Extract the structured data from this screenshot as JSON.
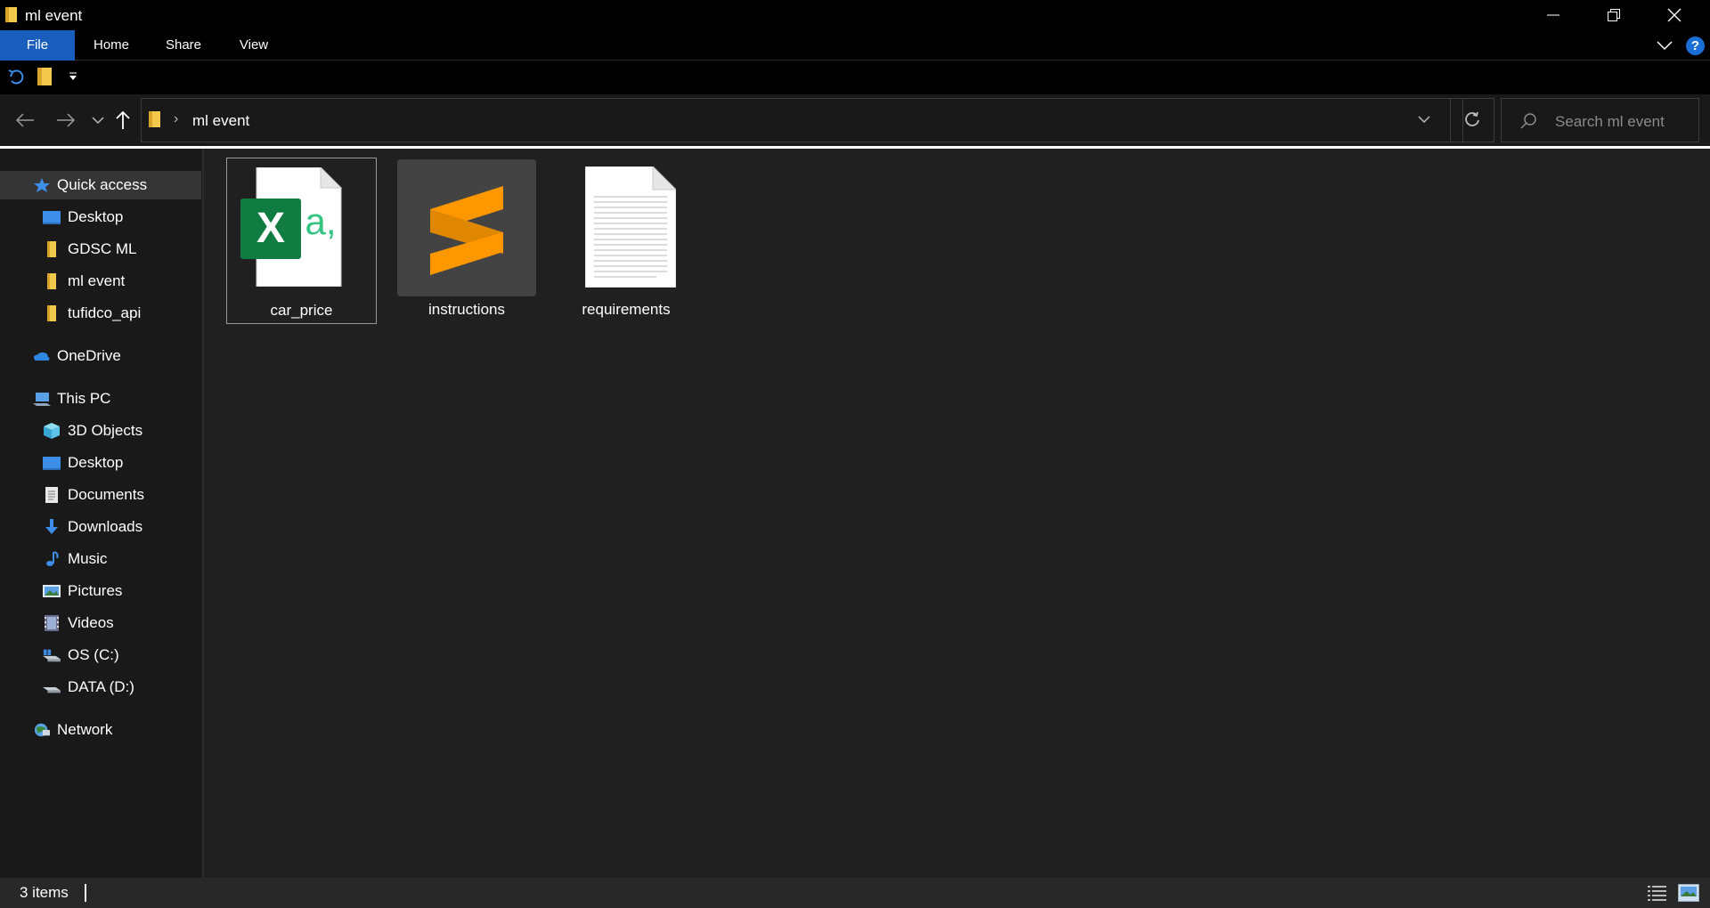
{
  "window": {
    "title": "ml event"
  },
  "ribbon": {
    "tabs": [
      {
        "label": "File"
      },
      {
        "label": "Home"
      },
      {
        "label": "Share"
      },
      {
        "label": "View"
      }
    ],
    "help_label": "?"
  },
  "address": {
    "separator": "›",
    "path": "ml event"
  },
  "search": {
    "placeholder": "Search ml event"
  },
  "sidebar": {
    "items": [
      {
        "label": "Quick access",
        "icon": "star-icon",
        "selected": true
      },
      {
        "label": "Desktop",
        "icon": "desktop-icon"
      },
      {
        "label": "GDSC ML",
        "icon": "folder-icon"
      },
      {
        "label": "ml event",
        "icon": "folder-icon"
      },
      {
        "label": "tufidco_api",
        "icon": "folder-icon"
      },
      {
        "label": "OneDrive",
        "icon": "cloud-icon"
      },
      {
        "label": "This PC",
        "icon": "computer-icon"
      },
      {
        "label": "3D Objects",
        "icon": "cube-icon"
      },
      {
        "label": "Desktop",
        "icon": "desktop-icon"
      },
      {
        "label": "Documents",
        "icon": "documents-icon"
      },
      {
        "label": "Downloads",
        "icon": "download-icon"
      },
      {
        "label": "Music",
        "icon": "music-icon"
      },
      {
        "label": "Pictures",
        "icon": "pictures-icon"
      },
      {
        "label": "Videos",
        "icon": "videos-icon"
      },
      {
        "label": "OS (C:)",
        "icon": "drive-icon"
      },
      {
        "label": "DATA (D:)",
        "icon": "drive-icon"
      },
      {
        "label": "Network",
        "icon": "network-icon"
      }
    ]
  },
  "files": [
    {
      "name": "car_price",
      "type": "excel-csv",
      "focused": true
    },
    {
      "name": "instructions",
      "type": "sublime",
      "hovered": true
    },
    {
      "name": "requirements",
      "type": "text"
    }
  ],
  "status": {
    "item_count": "3 items"
  },
  "colors": {
    "accent": "#1a5ebd",
    "excel_green": "#107c41",
    "sublime_orange": "#ff9800",
    "folder_yellow": "#f2c94c"
  }
}
